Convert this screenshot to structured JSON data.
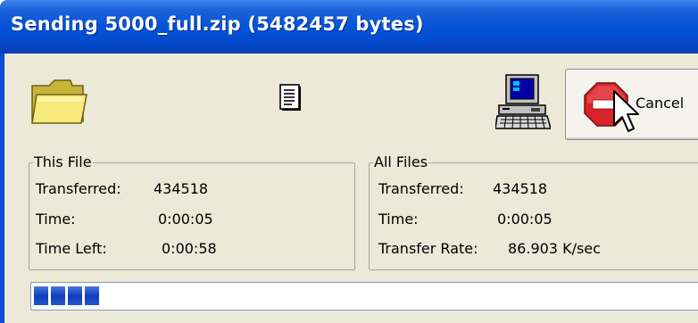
{
  "window": {
    "title": "Sending 5000_full.zip (5482457 bytes)"
  },
  "icons": {
    "source": "folder-icon",
    "file": "document-icon",
    "destination": "computer-icon",
    "cancel": "stop-sign-icon",
    "pointer": "mouse-cursor-icon"
  },
  "cancel_button": {
    "label": "Cancel"
  },
  "this_file": {
    "legend": "This File",
    "transferred_label": "Transferred:",
    "transferred_value": "434518",
    "time_label": "Time:",
    "time_value": "0:00:05",
    "time_left_label": "Time Left:",
    "time_left_value": "0:00:58"
  },
  "all_files": {
    "legend": "All Files",
    "transferred_label": "Transferred:",
    "transferred_value": "434518",
    "time_label": "Time:",
    "time_value": "0:00:05",
    "rate_label": "Transfer Rate:",
    "rate_value": "86.903 K/sec"
  },
  "progress": {
    "fraction": 0.08,
    "chunks": 4
  },
  "colors": {
    "title_bar": "#0052d8",
    "dialog_face": "#ece9d8",
    "progress_chunk": "#1c4ccd",
    "stop_sign": "#d8232a"
  }
}
